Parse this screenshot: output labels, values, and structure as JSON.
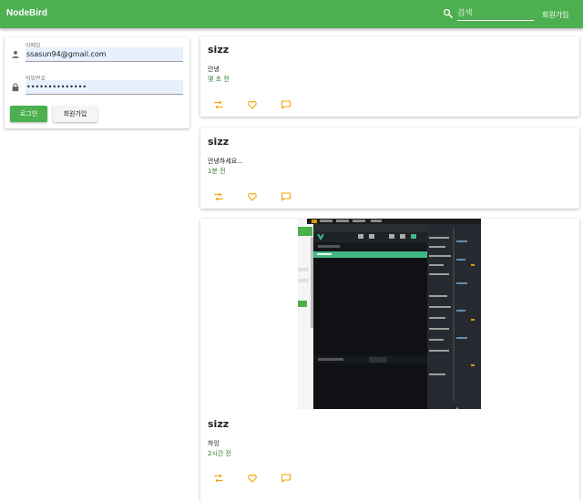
{
  "app": {
    "brand": "NodeBird"
  },
  "header": {
    "search_placeholder": "검색",
    "signup_label": "회원가입"
  },
  "login": {
    "email_label": "이메일",
    "email_value": "ssasun94@gmail.com",
    "password_label": "비밀번호",
    "password_value": "••••••••••••••",
    "login_button": "로그인",
    "signup_button": "회원가입"
  },
  "posts": [
    {
      "author": "sizz",
      "content": "안녕",
      "time": "몇 초 전"
    },
    {
      "author": "sizz",
      "content": "안녕하세요...",
      "time": "1분 전"
    },
    {
      "author": "sizz",
      "content": "하잉",
      "time": "2시간 전",
      "has_image": true
    }
  ],
  "colors": {
    "primary": "#4caf50",
    "time_text": "#2e7d32",
    "action_icon": "#f4a300"
  },
  "icons": {
    "search": "search-icon",
    "person": "person-icon",
    "lock": "lock-icon",
    "retweet": "retweet-icon",
    "heart": "heart-icon",
    "comment": "comment-icon"
  }
}
